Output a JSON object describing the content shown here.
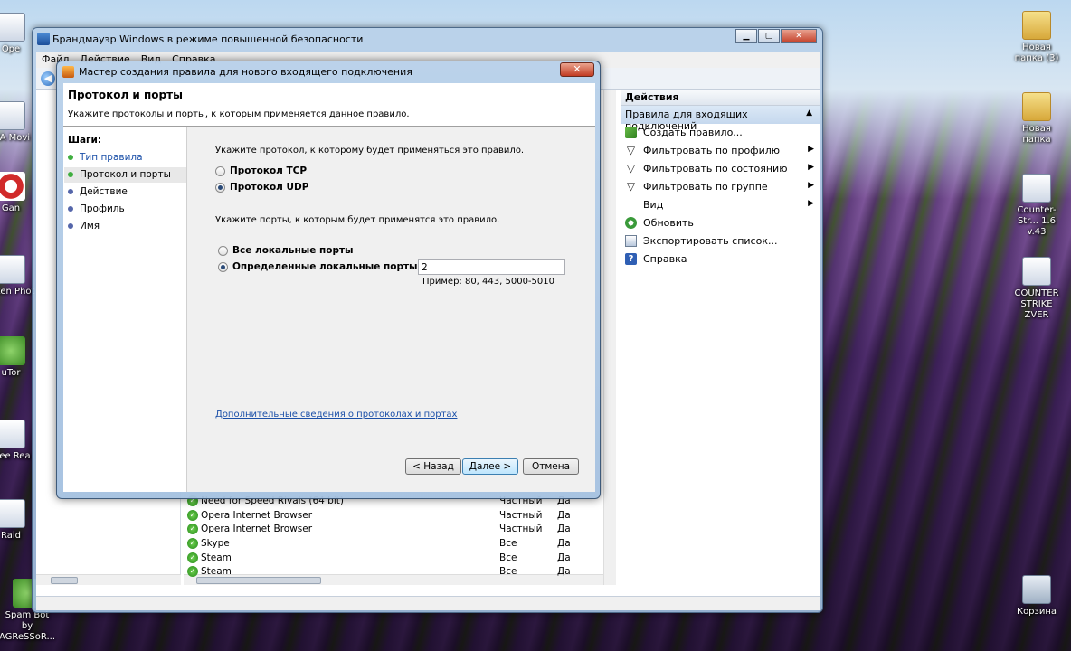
{
  "desktop": {
    "icons_left": [
      {
        "label": "Ope"
      },
      {
        "label": "MA Movi"
      },
      {
        "label": "Gan"
      },
      {
        "label": "Arten Phot"
      },
      {
        "label": "uTor"
      },
      {
        "label": "Free Rea"
      },
      {
        "label": "Raid"
      },
      {
        "label": "Spam Bot by AGReSSoR..."
      }
    ],
    "icons_right": [
      {
        "label": "Новая папка (3)"
      },
      {
        "label": "Новая папка"
      },
      {
        "label": "Counter-Str... 1.6 v.43"
      },
      {
        "label": "COUNTER STRIKE ZVER"
      },
      {
        "label": "Корзина"
      }
    ]
  },
  "mmc": {
    "title": "Брандмауэр Windows в режиме повышенной безопасности",
    "menu": [
      "Файл",
      "Действие",
      "Вид",
      "Справка"
    ],
    "actions": {
      "header": "Действия",
      "section": "Правила для входящих подключений",
      "items": [
        {
          "label": "Создать правило...",
          "icon": "new-rule-icon",
          "submenu": false
        },
        {
          "label": "Фильтровать по профилю",
          "icon": "filter-icon",
          "submenu": true
        },
        {
          "label": "Фильтровать по состоянию",
          "icon": "filter-icon",
          "submenu": true
        },
        {
          "label": "Фильтровать по группе",
          "icon": "filter-icon",
          "submenu": true
        },
        {
          "label": "Вид",
          "icon": "",
          "submenu": true
        },
        {
          "label": "Обновить",
          "icon": "refresh-icon",
          "submenu": false
        },
        {
          "label": "Экспортировать список...",
          "icon": "export-icon",
          "submenu": false
        },
        {
          "label": "Справка",
          "icon": "help-icon",
          "submenu": false
        }
      ]
    },
    "rules": [
      {
        "name": "Need for Speed Rivals (64 bit)",
        "profile": "Частный",
        "enabled": "Да"
      },
      {
        "name": "Opera Internet Browser",
        "profile": "Частный",
        "enabled": "Да"
      },
      {
        "name": "Opera Internet Browser",
        "profile": "Частный",
        "enabled": "Да"
      },
      {
        "name": "Skype",
        "profile": "Все",
        "enabled": "Да"
      },
      {
        "name": "Steam",
        "profile": "Все",
        "enabled": "Да"
      },
      {
        "name": "Steam",
        "profile": "Все",
        "enabled": "Да"
      }
    ]
  },
  "wizard": {
    "title": "Мастер создания правила для нового входящего подключения",
    "page_title": "Протокол и порты",
    "page_subtitle": "Укажите протоколы и порты, к которым применяется данное правило.",
    "steps_header": "Шаги:",
    "steps": [
      {
        "label": "Тип правила",
        "state": "done"
      },
      {
        "label": "Протокол и порты",
        "state": "current"
      },
      {
        "label": "Действие",
        "state": "pending"
      },
      {
        "label": "Профиль",
        "state": "pending"
      },
      {
        "label": "Имя",
        "state": "pending"
      }
    ],
    "protocol_prompt": "Укажите протокол, к которому будет применяться это правило.",
    "protocol_tcp": "Протокол TCP",
    "protocol_udp": "Протокол UDP",
    "protocol_selected": "udp",
    "ports_prompt": "Укажите порты, к которым будет применятся это правило.",
    "ports_all": "Все локальные порты",
    "ports_specific": "Определенные локальные порты:",
    "ports_selected": "specific",
    "ports_value": "2",
    "ports_example": "Пример: 80, 443, 5000-5010",
    "more_link": "Дополнительные сведения о протоколах и портах",
    "buttons": {
      "back": "< Назад",
      "next": "Далее >",
      "cancel": "Отмена"
    }
  }
}
